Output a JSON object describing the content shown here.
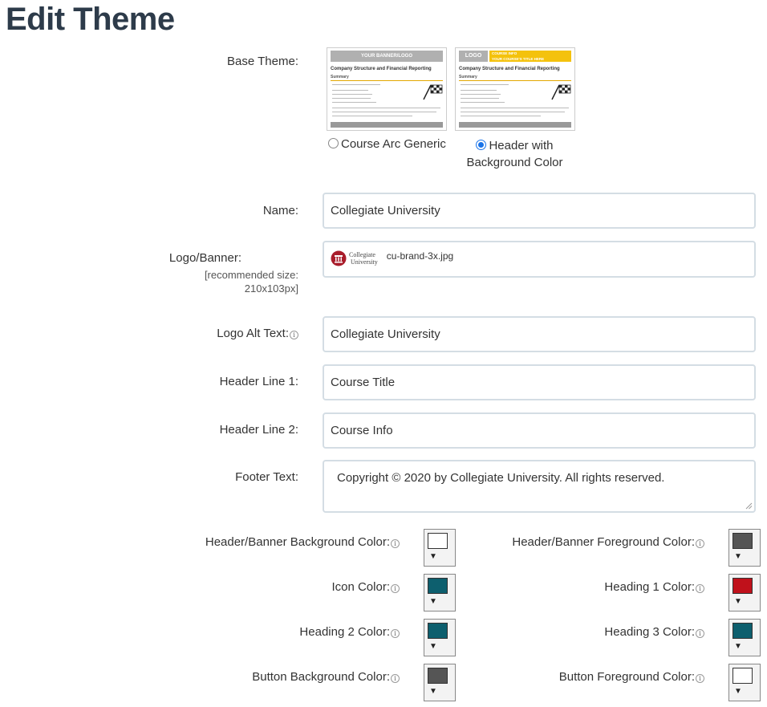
{
  "page_title": "Edit Theme",
  "base_theme": {
    "label": "Base Theme:",
    "options": [
      {
        "label": "Course Arc Generic",
        "selected": false,
        "preview": {
          "banner": "YOUR BANNER/LOGO",
          "heading": "Company Structure and Financial Reporting",
          "sub": "Summary"
        }
      },
      {
        "label_line1": "Header with",
        "label_line2": "Background Color",
        "selected": true,
        "preview": {
          "logo": "LOGO",
          "banner_line1": "COURSE INFO",
          "banner_line2": "YOUR COURSE'S TITLE HERE",
          "heading": "Company Structure and Financial Reporting",
          "sub": "Summary"
        }
      }
    ]
  },
  "name": {
    "label": "Name:",
    "value": "Collegiate University"
  },
  "logo_banner": {
    "label": "Logo/Banner:",
    "hint_line1": "[recommended size:",
    "hint_line2": "210x103px]",
    "logo_text1": "Collegiate",
    "logo_text2": "University",
    "filename": "cu-brand-3x.jpg"
  },
  "logo_alt": {
    "label": "Logo Alt Text:",
    "value": "Collegiate University"
  },
  "header1": {
    "label": "Header Line 1:",
    "value": "Course Title"
  },
  "header2": {
    "label": "Header Line 2:",
    "value": "Course Info"
  },
  "footer": {
    "label": "Footer Text:",
    "value": "Copyright © 2020 by Collegiate University. All rights reserved."
  },
  "colors": {
    "header_bg": {
      "label": "Header/Banner Background Color:",
      "color": "#ffffff"
    },
    "header_fg": {
      "label": "Header/Banner Foreground Color:",
      "color": "#555555"
    },
    "icon": {
      "label": "Icon Color:",
      "color": "#0d5f6e"
    },
    "heading1": {
      "label": "Heading 1 Color:",
      "color": "#c0111b"
    },
    "heading2": {
      "label": "Heading 2 Color:",
      "color": "#0d5f6e"
    },
    "heading3": {
      "label": "Heading 3 Color:",
      "color": "#0d5f6e"
    },
    "button_bg": {
      "label": "Button Background Color:",
      "color": "#555555"
    },
    "button_fg": {
      "label": "Button Foreground Color:",
      "color": "#ffffff"
    }
  },
  "info_glyph": "i",
  "dropdown_glyph": "▼"
}
